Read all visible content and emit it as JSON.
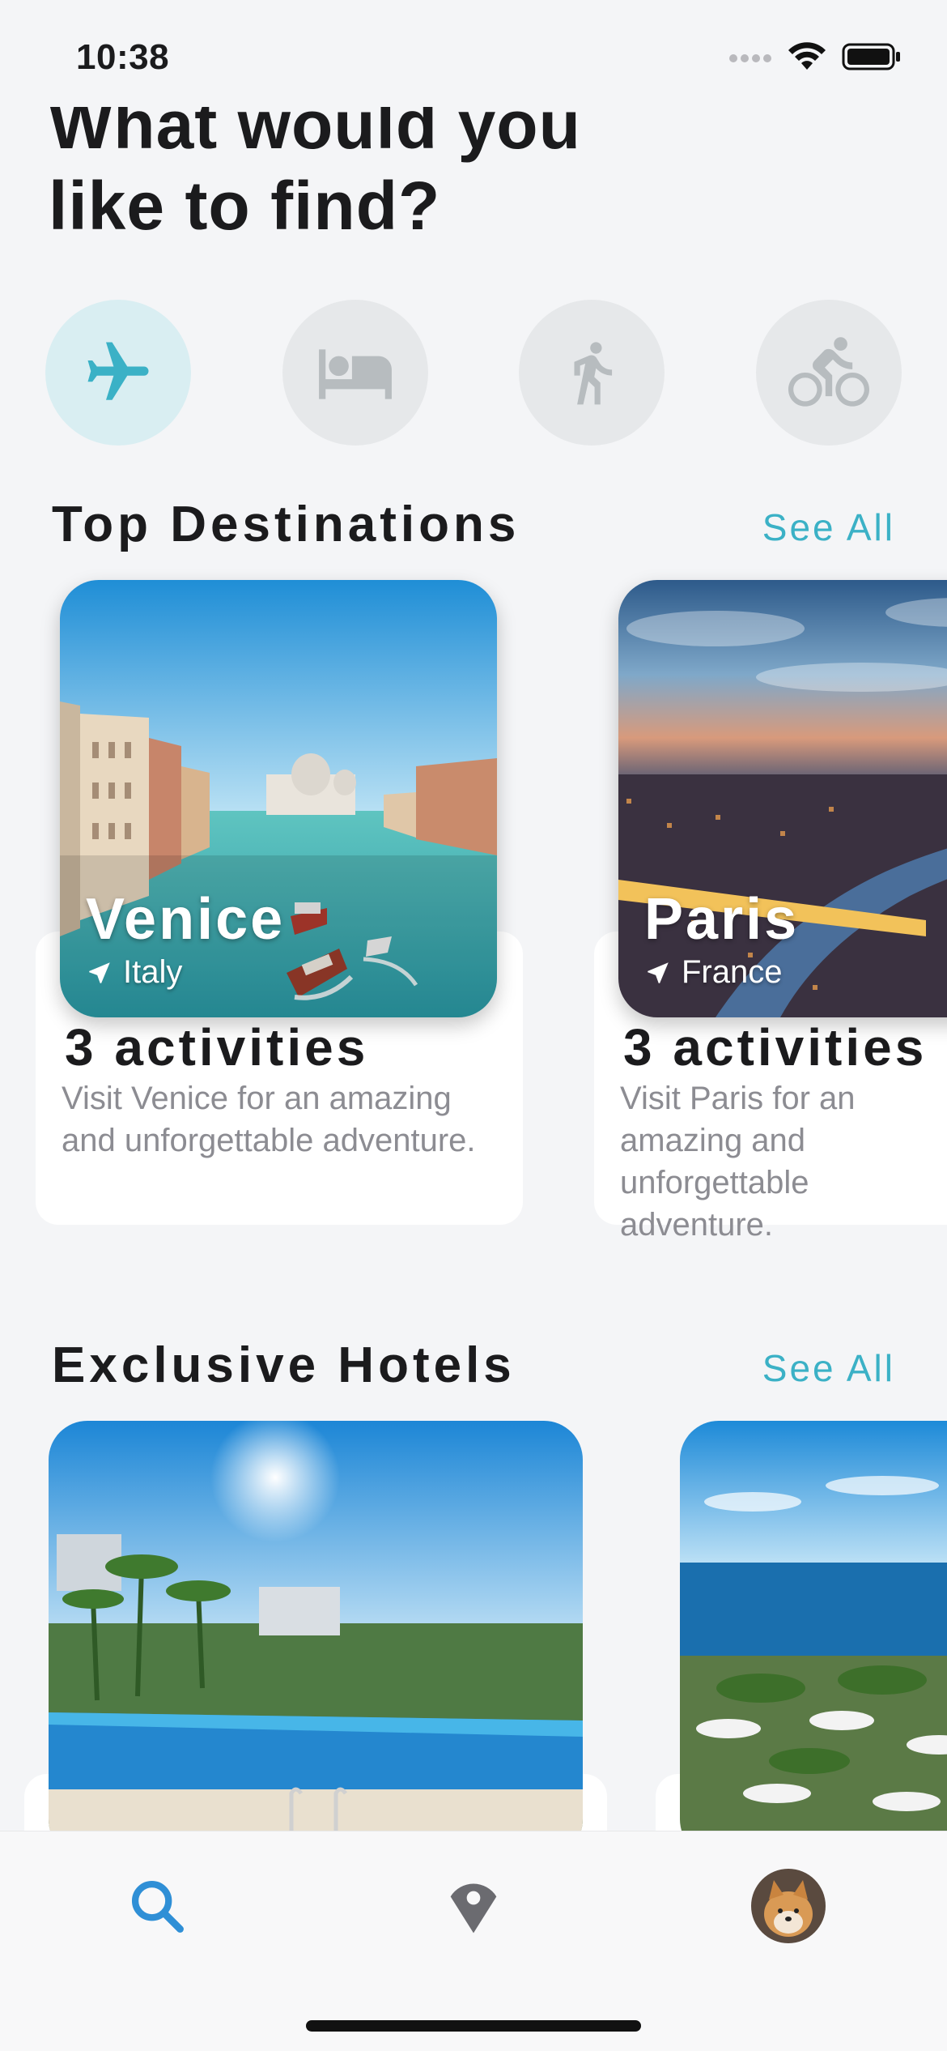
{
  "status_bar": {
    "time": "10:38"
  },
  "heading": {
    "line1": "What would you",
    "line2": "like to find?"
  },
  "categories": [
    {
      "icon": "airplane-icon",
      "active": true
    },
    {
      "icon": "bed-icon",
      "active": false
    },
    {
      "icon": "walking-icon",
      "active": false
    },
    {
      "icon": "bicycle-icon",
      "active": false
    }
  ],
  "top_destinations": {
    "title": "Top Destinations",
    "see_all": "See All",
    "items": [
      {
        "name": "Venice",
        "country": "Italy",
        "activities": "3 activities",
        "description": "Visit Venice for an amazing and unforgettable adventure."
      },
      {
        "name": "Paris",
        "country": "France",
        "activities": "3 activities",
        "description": "Visit Paris for an amazing and unforgettable adventure."
      }
    ]
  },
  "exclusive_hotels": {
    "title": "Exclusive Hotels",
    "see_all": "See All"
  },
  "tab_bar": {
    "items": [
      "search-icon",
      "map-pin-icon",
      "profile-avatar"
    ]
  },
  "colors": {
    "accent": "#3bb1c6",
    "background": "#f4f5f7",
    "active_tab": "#2f8fd6"
  }
}
